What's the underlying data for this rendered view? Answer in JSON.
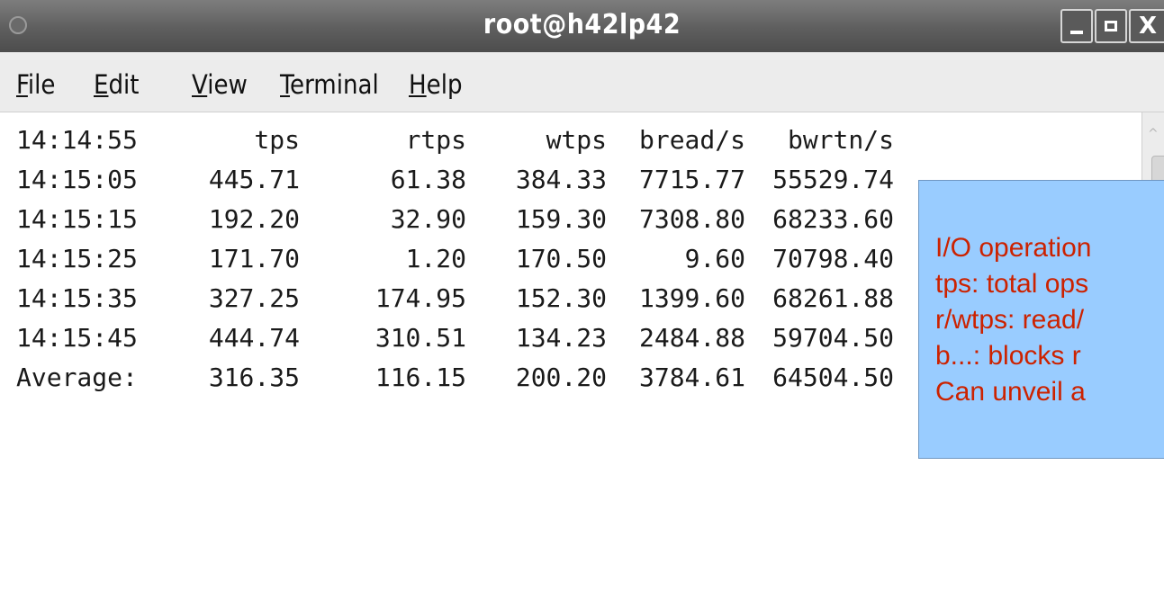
{
  "window": {
    "title": "root@h42lp42",
    "buttons": {
      "minimize": "_",
      "maximize": "□",
      "close": "X"
    }
  },
  "menu": [
    {
      "mnemonic": "F",
      "rest": "ile"
    },
    {
      "mnemonic": "E",
      "rest": "dit"
    },
    {
      "mnemonic": "V",
      "rest": "iew"
    },
    {
      "mnemonic": "T",
      "rest": "erminal"
    },
    {
      "mnemonic": "H",
      "rest": "elp"
    }
  ],
  "terminal": {
    "header": [
      "14:14:55",
      "tps",
      "rtps",
      "wtps",
      "bread/s",
      "bwrtn/s"
    ],
    "rows": [
      [
        "14:15:05",
        "445.71",
        "61.38",
        "384.33",
        "7715.77",
        "55529.74"
      ],
      [
        "14:15:15",
        "192.20",
        "32.90",
        "159.30",
        "7308.80",
        "68233.60"
      ],
      [
        "14:15:25",
        "171.70",
        "1.20",
        "170.50",
        "9.60",
        "70798.40"
      ],
      [
        "14:15:35",
        "327.25",
        "174.95",
        "152.30",
        "1399.60",
        "68261.88"
      ],
      [
        "14:15:45",
        "444.74",
        "310.51",
        "134.23",
        "2484.88",
        "59704.50"
      ],
      [
        "Average:",
        "316.35",
        "116.15",
        "200.20",
        "3784.61",
        "64504.50"
      ]
    ]
  },
  "note": {
    "lines": [
      "I/O operation",
      "tps: total ops",
      "r/wtps: read/",
      "b...: blocks r",
      "Can unveil a"
    ]
  }
}
